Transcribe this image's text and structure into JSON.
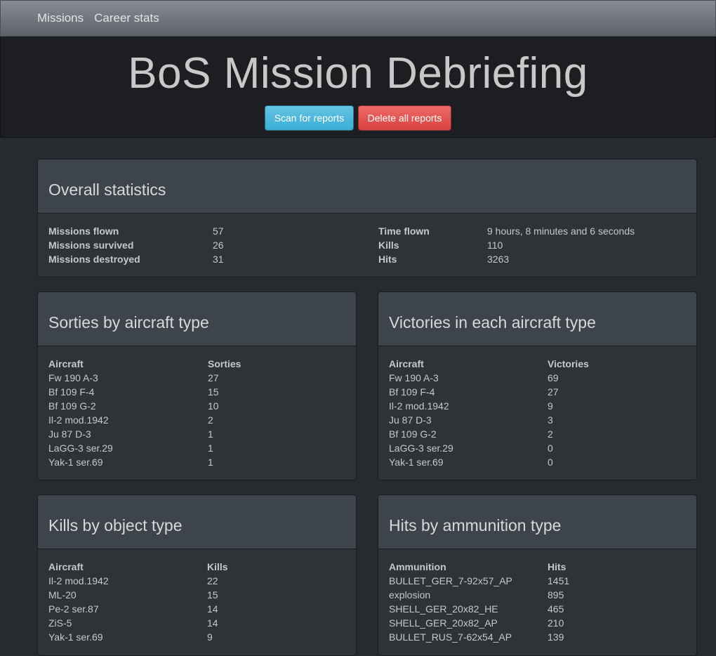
{
  "nav": {
    "missions": "Missions",
    "career_stats": "Career stats"
  },
  "header": {
    "title": "BoS Mission Debriefing",
    "scan_button": "Scan for reports",
    "delete_button": "Delete all reports"
  },
  "overall": {
    "title": "Overall statistics",
    "left": [
      {
        "label": "Missions flown",
        "value": "57"
      },
      {
        "label": "Missions survived",
        "value": "26"
      },
      {
        "label": "Missions destroyed",
        "value": "31"
      }
    ],
    "right": [
      {
        "label": "Time flown",
        "value": "9 hours, 8 minutes and 6 seconds"
      },
      {
        "label": "Kills",
        "value": "110"
      },
      {
        "label": "Hits",
        "value": "3263"
      }
    ]
  },
  "sorties": {
    "title": "Sorties by aircraft type",
    "headers": [
      "Aircraft",
      "Sorties"
    ],
    "rows": [
      [
        "Fw 190 A-3",
        "27"
      ],
      [
        "Bf 109 F-4",
        "15"
      ],
      [
        "Bf 109 G-2",
        "10"
      ],
      [
        "Il-2 mod.1942",
        "2"
      ],
      [
        "Ju 87 D-3",
        "1"
      ],
      [
        "LaGG-3 ser.29",
        "1"
      ],
      [
        "Yak-1 ser.69",
        "1"
      ]
    ]
  },
  "victories": {
    "title": "Victories in each aircraft type",
    "headers": [
      "Aircraft",
      "Victories"
    ],
    "rows": [
      [
        "Fw 190 A-3",
        "69"
      ],
      [
        "Bf 109 F-4",
        "27"
      ],
      [
        "Il-2 mod.1942",
        "9"
      ],
      [
        "Ju 87 D-3",
        "3"
      ],
      [
        "Bf 109 G-2",
        "2"
      ],
      [
        "LaGG-3 ser.29",
        "0"
      ],
      [
        "Yak-1 ser.69",
        "0"
      ]
    ]
  },
  "kills": {
    "title": "Kills by object type",
    "headers": [
      "Aircraft",
      "Kills"
    ],
    "rows": [
      [
        "Il-2 mod.1942",
        "22"
      ],
      [
        "ML-20",
        "15"
      ],
      [
        "Pe-2 ser.87",
        "14"
      ],
      [
        "ZiS-5",
        "14"
      ],
      [
        "Yak-1 ser.69",
        "9"
      ]
    ]
  },
  "hits": {
    "title": "Hits by ammunition type",
    "headers": [
      "Ammunition",
      "Hits"
    ],
    "rows": [
      [
        "BULLET_GER_7-92x57_AP",
        "1451"
      ],
      [
        "explosion",
        "895"
      ],
      [
        "SHELL_GER_20x82_HE",
        "465"
      ],
      [
        "SHELL_GER_20x82_AP",
        "210"
      ],
      [
        "BULLET_RUS_7-62x54_AP",
        "139"
      ]
    ]
  }
}
